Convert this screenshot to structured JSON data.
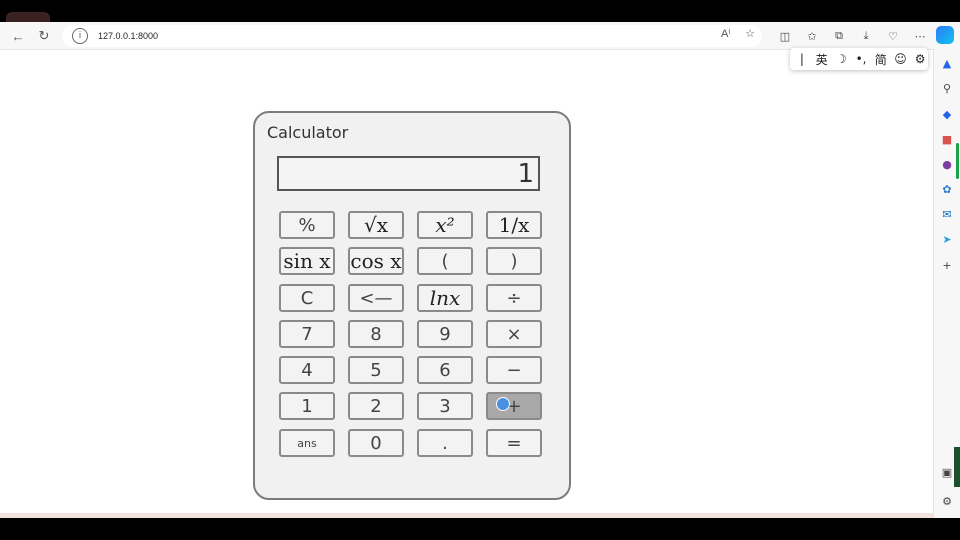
{
  "browser": {
    "url": "127.0.0.1:8000",
    "nav_icons": {
      "back": "back-arrow-icon",
      "reload": "reload-icon"
    },
    "url_icons": [
      "read-aloud-icon",
      "favorite-star-icon"
    ],
    "toolbar_icons": [
      "split-screen-icon",
      "favorites-icon",
      "collections-icon",
      "downloads-icon",
      "browser-essentials-icon",
      "more-icon",
      "copilot-icon"
    ],
    "sidebar_icons": [
      "bell-icon",
      "search-icon",
      "shopping-tag-icon",
      "tools-icon",
      "people-icon",
      "office-icon",
      "outlook-icon",
      "telegram-icon",
      "add-icon",
      "screen-share-icon",
      "settings-icon"
    ]
  },
  "ime_toolbar": {
    "items": [
      "|",
      "英",
      "☽",
      "•,",
      "简",
      "☺",
      "⚙"
    ]
  },
  "calculator": {
    "title": "Calculator",
    "display_value": "1",
    "keys": {
      "percent": "%",
      "sqrt": "√x",
      "square": "x²",
      "reciprocal": "1/x",
      "sin": "sin x",
      "cos": "cos x",
      "open_paren": "(",
      "close_paren": ")",
      "clear": "C",
      "backspace": "<—",
      "ln": "lnx",
      "divide": "÷",
      "seven": "7",
      "eight": "8",
      "nine": "9",
      "multiply": "×",
      "four": "4",
      "five": "5",
      "six": "6",
      "minus": "−",
      "one": "1",
      "two": "2",
      "three": "3",
      "plus": "+",
      "ans": "ans",
      "zero": "0",
      "dot": ".",
      "equals": "="
    },
    "hovered_key": "plus"
  }
}
